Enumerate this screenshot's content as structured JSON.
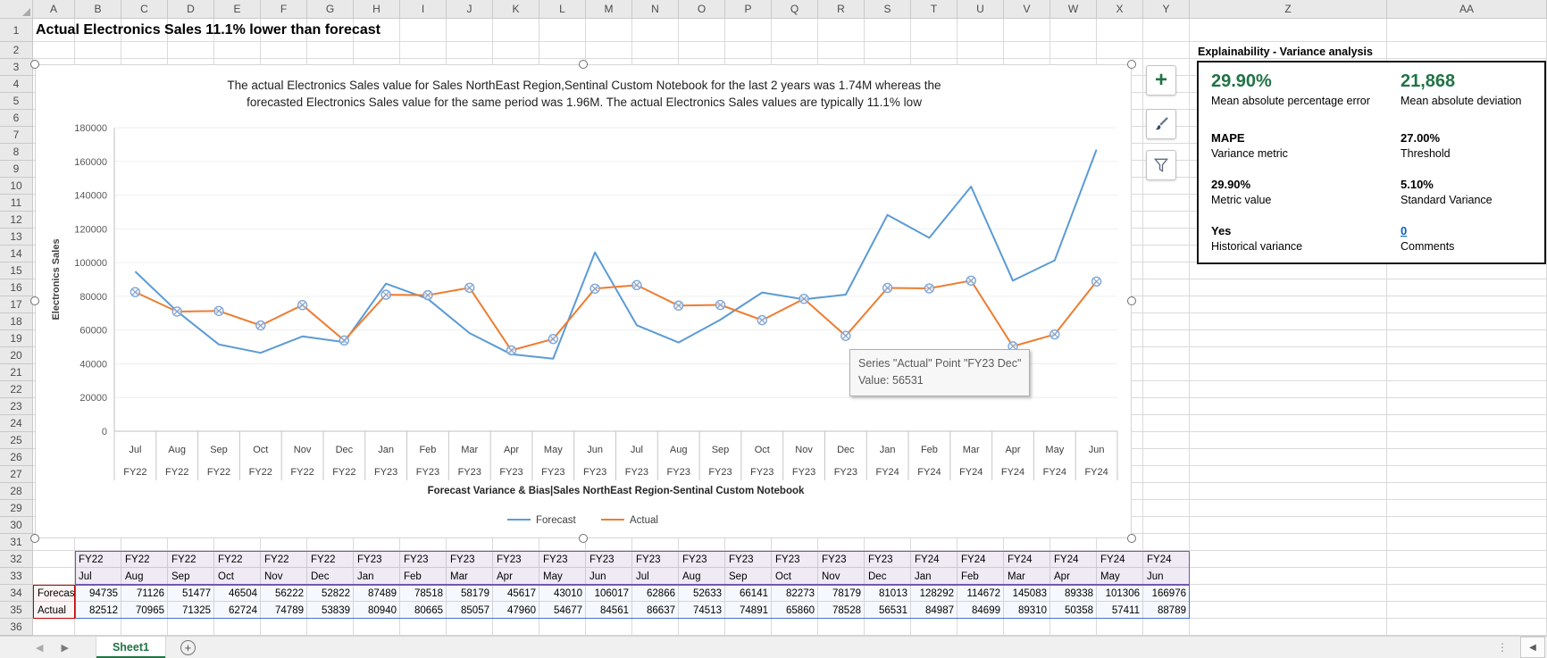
{
  "title_cell": "Actual Electronics Sales 11.1% lower than forecast",
  "grid": {
    "columns": [
      "A",
      "B",
      "C",
      "D",
      "E",
      "F",
      "G",
      "H",
      "I",
      "J",
      "K",
      "L",
      "M",
      "N",
      "O",
      "P",
      "Q",
      "R",
      "S",
      "T",
      "U",
      "V",
      "W",
      "X",
      "Y",
      "Z",
      "AA"
    ],
    "rows": [
      1,
      2,
      3,
      4,
      5,
      6,
      7,
      8,
      9,
      10,
      11,
      12,
      13,
      14,
      15,
      16,
      17,
      18,
      19,
      20,
      21,
      22,
      23,
      24,
      25,
      26,
      27,
      28,
      29,
      30,
      31,
      32,
      33,
      34,
      35,
      36
    ]
  },
  "chart_data": {
    "type": "line",
    "title_lines": [
      "The actual Electronics Sales value for Sales NorthEast Region,Sentinal Custom Notebook for the last 2 years was 1.74M whereas the",
      "forecasted Electronics Sales value for the same period was 1.96M. The actual Electronics Sales values are typically 11.1% low"
    ],
    "ylabel": "Electronics Sales",
    "xlabel": "Forecast Variance & Bias|Sales NorthEast Region-Sentinal Custom Notebook",
    "ylim": [
      0,
      180000
    ],
    "y_ticks": [
      0,
      20000,
      40000,
      60000,
      80000,
      100000,
      120000,
      140000,
      160000,
      180000
    ],
    "grid_on": true,
    "legend_position": "bottom",
    "months": [
      "Jul",
      "Aug",
      "Sep",
      "Oct",
      "Nov",
      "Dec",
      "Jan",
      "Feb",
      "Mar",
      "Apr",
      "May",
      "Jun",
      "Jul",
      "Aug",
      "Sep",
      "Oct",
      "Nov",
      "Dec",
      "Jan",
      "Feb",
      "Mar",
      "Apr",
      "May",
      "Jun"
    ],
    "years": [
      "FY22",
      "FY22",
      "FY22",
      "FY22",
      "FY22",
      "FY22",
      "FY23",
      "FY23",
      "FY23",
      "FY23",
      "FY23",
      "FY23",
      "FY23",
      "FY23",
      "FY23",
      "FY23",
      "FY23",
      "FY23",
      "FY24",
      "FY24",
      "FY24",
      "FY24",
      "FY24",
      "FY24"
    ],
    "series": [
      {
        "name": "Forecast",
        "color": "#5B9BD5",
        "values": [
          94735,
          71126,
          51477,
          46504,
          56222,
          52822,
          87489,
          78518,
          58179,
          45617,
          43010,
          106017,
          62866,
          52633,
          66141,
          82273,
          78179,
          81013,
          128292,
          114672,
          145083,
          89338,
          101306,
          166976
        ]
      },
      {
        "name": "Actual",
        "color": "#ED7D31",
        "values": [
          82512,
          70965,
          71325,
          62724,
          74789,
          53839,
          80940,
          80665,
          85057,
          47960,
          54677,
          84561,
          86637,
          74513,
          74891,
          65860,
          78528,
          56531,
          84987,
          84699,
          89310,
          50358,
          57411,
          88789
        ]
      }
    ]
  },
  "chart": {
    "tooltip": {
      "line1": "Series \"Actual\" Point \"FY23 Dec\"",
      "line2": "Value: 56531"
    }
  },
  "panel": {
    "title": "Explainability - Variance analysis",
    "items": [
      {
        "value": "29.90%",
        "label": "Mean absolute percentage error",
        "style": "big"
      },
      {
        "value": "21,868",
        "label": "Mean absolute deviation",
        "style": "big"
      },
      {
        "value": "MAPE",
        "label": "Variance metric",
        "style": "bold"
      },
      {
        "value": "27.00%",
        "label": "Threshold",
        "style": "bold"
      },
      {
        "value": "29.90%",
        "label": "Metric value",
        "style": "bold"
      },
      {
        "value": "5.10%",
        "label": "Standard Variance",
        "style": "bold"
      },
      {
        "value": "Yes",
        "label": "Historical variance",
        "style": "bold"
      },
      {
        "value": "0",
        "label": "Comments",
        "style": "link"
      }
    ]
  },
  "tabbar": {
    "sheet": "Sheet1"
  },
  "icons": {
    "nav_left": "◀",
    "nav_right": "▶",
    "plus": "+",
    "dots": "⋮",
    "scroll_left": "◀"
  }
}
